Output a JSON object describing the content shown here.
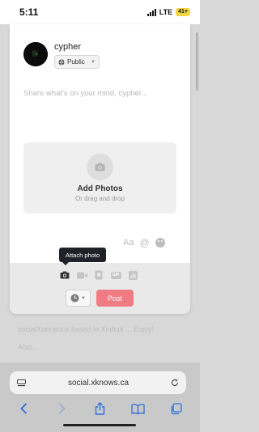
{
  "status_bar": {
    "time": "5:11",
    "network": "LTE",
    "battery": "41+"
  },
  "composer": {
    "username": "cypher",
    "visibility": "Public",
    "placeholder": "Share what's on your mind, cypher...",
    "dropzone_title": "Add Photos",
    "dropzone_subtitle": "Or drag and drop",
    "format_label": "Aa",
    "mention_label": "@",
    "tooltip": "Attach photo",
    "gif_label": "GIF",
    "post_button": "Post",
    "colors": {
      "post": "#f07c83",
      "tooltip": "#1f2228"
    }
  },
  "background_page": {
    "line1": "socialXperience based in Xinhua ... Enjoy!",
    "line2": "Also..."
  },
  "browser": {
    "url": "social.xknows.ca"
  },
  "icons": [
    "globe-icon",
    "camera-icon",
    "video-icon",
    "clip-icon",
    "gif-icon",
    "poll-icon",
    "clock-icon",
    "emoji-icon",
    "reload-icon",
    "back-icon",
    "forward-icon",
    "share-icon",
    "bookmarks-icon",
    "tabs-icon"
  ]
}
